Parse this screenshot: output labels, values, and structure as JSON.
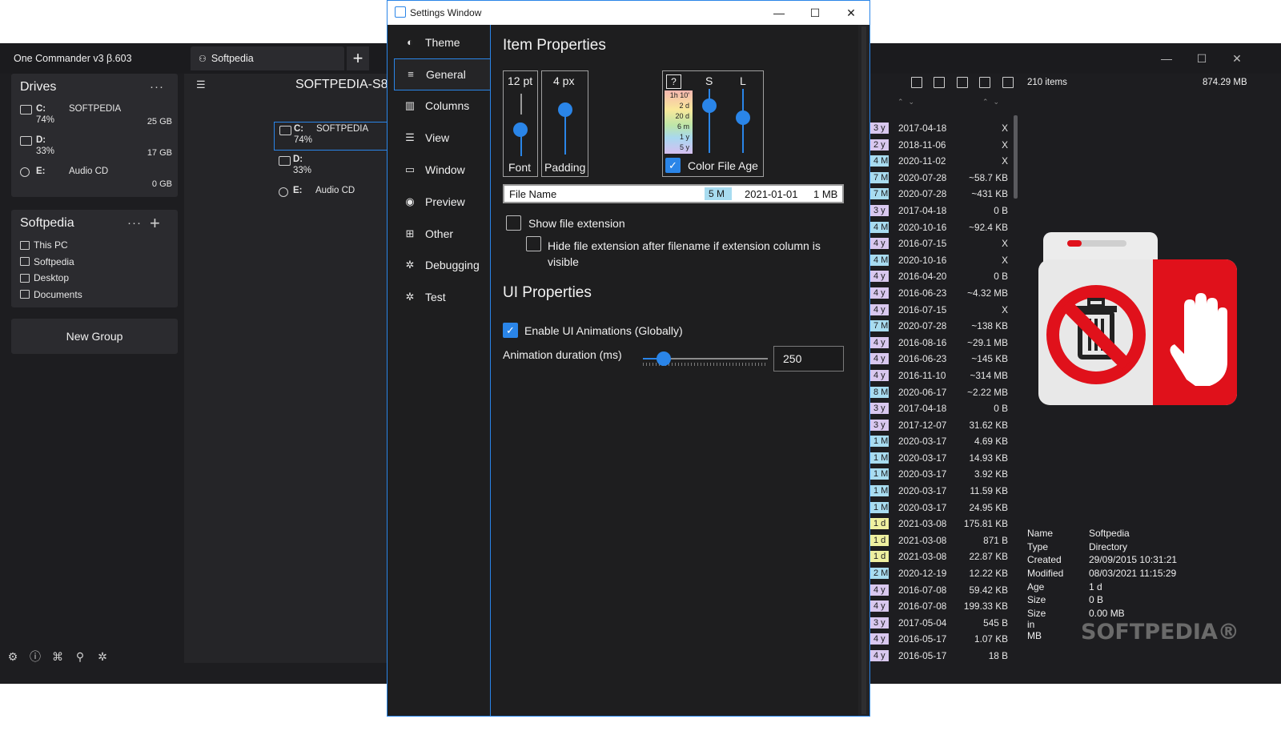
{
  "app": {
    "title": "One Commander v3 β.603",
    "tab_label": "Softpedia",
    "path_title": "SOFTPEDIA-S8"
  },
  "drives_card": {
    "title": "Drives",
    "more": "···",
    "drives": [
      {
        "letter": "C:",
        "label": "SOFTPEDIA",
        "pct": "74%",
        "size": "25 GB"
      },
      {
        "letter": "D:",
        "label": "",
        "pct": "33%",
        "size": "17 GB"
      },
      {
        "letter": "E:",
        "label": "Audio CD",
        "pct": "",
        "size": "0 GB"
      }
    ]
  },
  "group_card": {
    "title": "Softpedia",
    "more": "···",
    "add": "+",
    "items": [
      "This PC",
      "Softpedia",
      "Desktop",
      "Documents"
    ]
  },
  "new_group": "New Group",
  "mid_drives": [
    {
      "letter": "C:",
      "label": "SOFTPEDIA",
      "pct": "74%"
    },
    {
      "letter": "D:",
      "label": "",
      "pct": "33%"
    },
    {
      "letter": "E:",
      "label": "Audio CD",
      "pct": ""
    }
  ],
  "right_pane": {
    "items_count": "210 items",
    "items_size": "874.29 MB",
    "rows": [
      {
        "age": "3 y",
        "date": "2017-04-18",
        "size": "X",
        "color": "#d9c8ef"
      },
      {
        "age": "2 y",
        "date": "2018-11-06",
        "size": "X",
        "color": "#d9c8ef"
      },
      {
        "age": "4 M",
        "date": "2020-11-02",
        "size": "X",
        "color": "#a8dcf0"
      },
      {
        "age": "7 M",
        "date": "2020-07-28",
        "size": "~58.7 KB",
        "color": "#a8dcf0"
      },
      {
        "age": "7 M",
        "date": "2020-07-28",
        "size": "~431 KB",
        "color": "#a8dcf0"
      },
      {
        "age": "3 y",
        "date": "2017-04-18",
        "size": "0 B",
        "color": "#d9c8ef"
      },
      {
        "age": "4 M",
        "date": "2020-10-16",
        "size": "~92.4 KB",
        "color": "#a8dcf0"
      },
      {
        "age": "4 y",
        "date": "2016-07-15",
        "size": "X",
        "color": "#d9c8ef"
      },
      {
        "age": "4 M",
        "date": "2020-10-16",
        "size": "X",
        "color": "#a8dcf0"
      },
      {
        "age": "4 y",
        "date": "2016-04-20",
        "size": "0 B",
        "color": "#d9c8ef"
      },
      {
        "age": "4 y",
        "date": "2016-06-23",
        "size": "~4.32 MB",
        "color": "#d9c8ef"
      },
      {
        "age": "4 y",
        "date": "2016-07-15",
        "size": "X",
        "color": "#d9c8ef"
      },
      {
        "age": "7 M",
        "date": "2020-07-28",
        "size": "~138 KB",
        "color": "#a8dcf0"
      },
      {
        "age": "4 y",
        "date": "2016-08-16",
        "size": "~29.1 MB",
        "color": "#d9c8ef"
      },
      {
        "age": "4 y",
        "date": "2016-06-23",
        "size": "~145 KB",
        "color": "#d9c8ef"
      },
      {
        "age": "4 y",
        "date": "2016-11-10",
        "size": "~314 MB",
        "color": "#d9c8ef"
      },
      {
        "age": "8 M",
        "date": "2020-06-17",
        "size": "~2.22 MB",
        "color": "#a8dcf0"
      },
      {
        "age": "3 y",
        "date": "2017-04-18",
        "size": "0 B",
        "color": "#d9c8ef"
      },
      {
        "age": "3 y",
        "date": "2017-12-07",
        "size": "31.62 KB",
        "color": "#d9c8ef"
      },
      {
        "age": "1 M",
        "date": "2020-03-17",
        "size": "4.69 KB",
        "color": "#a8dcf0"
      },
      {
        "age": "1 M",
        "date": "2020-03-17",
        "size": "14.93 KB",
        "color": "#a8dcf0"
      },
      {
        "age": "1 M",
        "date": "2020-03-17",
        "size": "3.92 KB",
        "color": "#a8dcf0"
      },
      {
        "age": "1 M",
        "date": "2020-03-17",
        "size": "11.59 KB",
        "color": "#a8dcf0"
      },
      {
        "age": "1 M",
        "date": "2020-03-17",
        "size": "24.95 KB",
        "color": "#a8dcf0"
      },
      {
        "age": "1 d",
        "date": "2021-03-08",
        "size": "175.81 KB",
        "color": "#eef0a0"
      },
      {
        "age": "1 d",
        "date": "2021-03-08",
        "size": "871 B",
        "color": "#eef0a0"
      },
      {
        "age": "1 d",
        "date": "2021-03-08",
        "size": "22.87 KB",
        "color": "#eef0a0"
      },
      {
        "age": "2 M",
        "date": "2020-12-19",
        "size": "12.22 KB",
        "color": "#a8dcf0"
      },
      {
        "age": "4 y",
        "date": "2016-07-08",
        "size": "59.42 KB",
        "color": "#d9c8ef"
      },
      {
        "age": "4 y",
        "date": "2016-07-08",
        "size": "199.33 KB",
        "color": "#d9c8ef"
      },
      {
        "age": "3 y",
        "date": "2017-05-04",
        "size": "545 B",
        "color": "#d9c8ef"
      },
      {
        "age": "4 y",
        "date": "2016-05-17",
        "size": "1.07 KB",
        "color": "#d9c8ef"
      },
      {
        "age": "4 y",
        "date": "2016-05-17",
        "size": "18 B",
        "color": "#d9c8ef"
      }
    ],
    "properties": [
      {
        "key": "Name",
        "value": "Softpedia"
      },
      {
        "key": "Type",
        "value": "Directory"
      },
      {
        "key": "Created",
        "value": "29/09/2015 10:31:21"
      },
      {
        "key": "Modified",
        "value": "08/03/2021 11:15:29"
      },
      {
        "key": "Age",
        "value": "1 d"
      },
      {
        "key": "Size",
        "value": "0 B"
      },
      {
        "key": "Size in MB",
        "value": "0.00 MB"
      }
    ],
    "watermark": "SOFTPEDIA®"
  },
  "settings": {
    "title": "Settings Window",
    "nav": [
      {
        "label": "Theme",
        "icon": "palette-icon"
      },
      {
        "label": "General",
        "icon": "sliders-icon"
      },
      {
        "label": "Columns",
        "icon": "columns-icon"
      },
      {
        "label": "View",
        "icon": "list-view-icon"
      },
      {
        "label": "Window",
        "icon": "window-icon"
      },
      {
        "label": "Preview",
        "icon": "eye-icon"
      },
      {
        "label": "Other",
        "icon": "add-box-icon"
      },
      {
        "label": "Debugging",
        "icon": "bug-icon"
      },
      {
        "label": "Test",
        "icon": "bug-icon"
      }
    ],
    "active_nav": "General",
    "item_properties": {
      "heading": "Item Properties",
      "font_value": "12 pt",
      "font_label": "Font",
      "padding_value": "4 px",
      "padding_label": "Padding",
      "help": "?",
      "s_label": "S",
      "l_label": "L",
      "age_scale": [
        "1h 10'",
        "2 d",
        "20 d",
        "6 m",
        "1 y",
        "5 y"
      ],
      "color_file_age_label": "Color File Age",
      "color_file_age_checked": true,
      "preview": {
        "name": "File Name",
        "age": "5 M",
        "date": "2021-01-01",
        "size": "1 MB"
      },
      "show_ext_label": "Show file extension",
      "show_ext_checked": false,
      "hide_ext_label": "Hide file extension after filename if extension column is visible",
      "hide_ext_checked": false
    },
    "ui_properties": {
      "heading": "UI Properties",
      "animations_label": "Enable UI Animations (Globally)",
      "animations_checked": true,
      "duration_label": "Animation duration (ms)",
      "duration_value": "250"
    }
  },
  "colors": {
    "accent": "#2a85e8",
    "bg_dark": "#1d1d20",
    "card": "#2b2b2f",
    "folder_red": "#e0111b"
  }
}
